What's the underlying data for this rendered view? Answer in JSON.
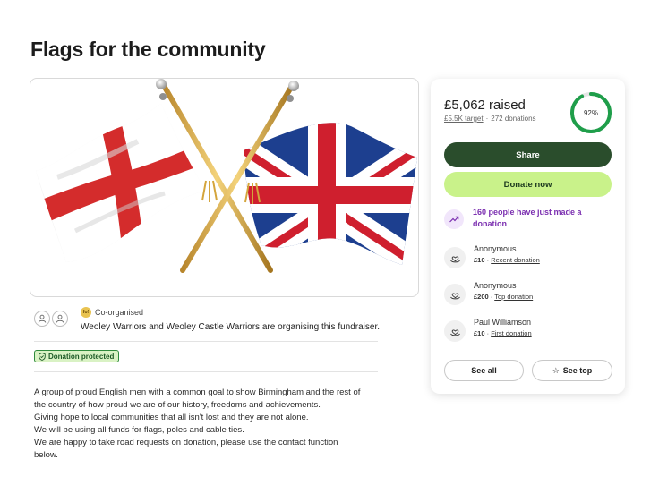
{
  "page": {
    "title": "Flags for the community",
    "hero_image": "crossed-flags-england-union-jack"
  },
  "organiser": {
    "badge_text": "fo!",
    "co_label": "Co-organised",
    "text": "Weoley Warriors and Weoley Castle Warriors are organising this fundraiser."
  },
  "protection": {
    "label": "Donation protected"
  },
  "description": {
    "lines": [
      "A group of proud English men with a common goal to show Birmingham and the rest of",
      "the country of how proud we are of our history, freedoms and achievements.",
      "Giving hope to local communities that all isn't lost and they are not alone.",
      "We will be using all funds for flags, poles and cable ties.",
      "We are happy to take road requests on donation, please use the contact function",
      "below."
    ]
  },
  "donation_card": {
    "raised": "£5,062 raised",
    "target": "£5.5K target",
    "separator": "·",
    "donations_count": "272 donations",
    "progress_percent": 92,
    "progress_label": "92%",
    "share_label": "Share",
    "donate_label": "Donate now",
    "trend_text": "160 people have just made a donation",
    "donors": [
      {
        "name": "Anonymous",
        "amount": "£10",
        "dot": " · ",
        "kind": "Recent donation"
      },
      {
        "name": "Anonymous",
        "amount": "£200",
        "dot": " · ",
        "kind": "Top donation"
      },
      {
        "name": "Paul Williamson",
        "amount": "£10",
        "dot": " · ",
        "kind": "First donation"
      }
    ],
    "see_all_label": "See all",
    "see_top_label": "See top"
  },
  "colors": {
    "share_button": "#2a4d2c",
    "donate_button": "#c9f28a",
    "progress_ring": "#1f9e4a",
    "trend_text": "#7b2fb0",
    "protected_badge_bg": "#d9f2c4"
  }
}
